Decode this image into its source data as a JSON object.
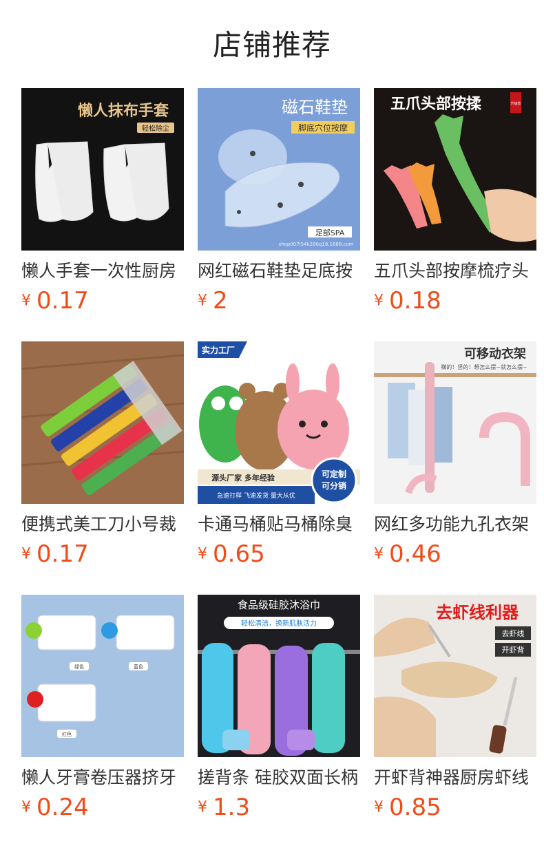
{
  "header": {
    "title": "店铺推荐"
  },
  "currency_symbol": "¥",
  "products": [
    {
      "name": "懒人手套一次性厨房",
      "price": "0.17",
      "image_texts": [
        "懒人抹布手套",
        "轻松除尘"
      ]
    },
    {
      "name": "网红磁石鞋垫足底按",
      "price": "2",
      "image_texts": [
        "磁石鞋垫",
        "脚底穴位按摩",
        "足部SPA",
        "shop007l54k280q18.1688.com"
      ]
    },
    {
      "name": "五爪头部按摩梳疗头",
      "price": "0.18",
      "image_texts": [
        "五爪头部按揉",
        "升级款"
      ]
    },
    {
      "name": "便携式美工刀小号裁",
      "price": "0.17",
      "image_texts": []
    },
    {
      "name": "卡通马桶贴马桶除臭",
      "price": "0.65",
      "image_texts": [
        "实力工厂",
        "源头厂家 多年经验",
        "急速打样 飞速发货 量大从优",
        "可定制",
        "可分销"
      ]
    },
    {
      "name": "网红多功能九孔衣架",
      "price": "0.46",
      "image_texts": [
        "可移动衣架",
        "横的！竖的！想怎么摆~就怎么摆~"
      ]
    },
    {
      "name": "懒人牙膏卷压器挤牙",
      "price": "0.24",
      "image_texts": [
        "绿色",
        "蓝色",
        "红色"
      ]
    },
    {
      "name": "搓背条 硅胶双面长柄",
      "price": "1.3",
      "image_texts": [
        "食品级硅胶沐浴巾",
        "轻松清洁，换新肌肤活力"
      ]
    },
    {
      "name": "开虾背神器厨房虾线",
      "price": "0.85",
      "image_texts": [
        "去虾线利器",
        "去虾线",
        "开虾背"
      ]
    }
  ]
}
